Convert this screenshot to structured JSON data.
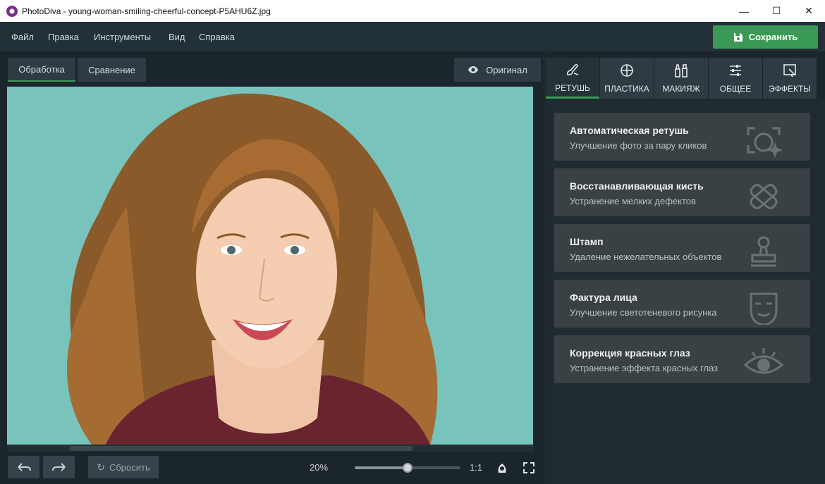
{
  "window": {
    "title": "PhotoDiva - young-woman-smiling-cheerful-concept-P5AHU6Z.jpg",
    "controls": {
      "minimize": "—",
      "maximize": "☐",
      "close": "✕"
    }
  },
  "menu": {
    "items": [
      "Файл",
      "Правка",
      "Инструменты",
      "Вид",
      "Справка"
    ],
    "save_label": "Сохранить"
  },
  "view_tabs": [
    {
      "label": "Обработка",
      "active": true
    },
    {
      "label": "Сравнение",
      "active": false
    }
  ],
  "original_label": "Оригинал",
  "canvas": {
    "background_color": "#78c4bd"
  },
  "bottom": {
    "reset_label": "Сбросить",
    "zoom": "20%",
    "zoom_fraction": 0.5,
    "one_to_one": "1:1"
  },
  "tool_tabs": [
    {
      "label": "РЕТУШЬ",
      "icon": "brush-retouch-icon",
      "active": true
    },
    {
      "label": "ПЛАСТИКА",
      "icon": "crosshair-icon",
      "active": false
    },
    {
      "label": "МАКИЯЖ",
      "icon": "makeup-icon",
      "active": false
    },
    {
      "label": "ОБЩЕЕ",
      "icon": "sliders-icon",
      "active": false
    },
    {
      "label": "ЭФФЕКТЫ",
      "icon": "effects-icon",
      "active": false
    }
  ],
  "tools": [
    {
      "title": "Автоматическая ретушь",
      "desc": "Улучшение фото за пару кликов",
      "icon": "auto-retouch-icon"
    },
    {
      "title": "Восстанавливающая кисть",
      "desc": "Устранение мелких дефектов",
      "icon": "bandage-icon"
    },
    {
      "title": "Штамп",
      "desc": "Удаление нежелательных объектов",
      "icon": "stamp-icon"
    },
    {
      "title": "Фактура лица",
      "desc": "Улучшение светотеневого рисунка",
      "icon": "face-mask-icon"
    },
    {
      "title": "Коррекция красных глаз",
      "desc": "Устранение эффекта красных глаз",
      "icon": "eye-icon"
    }
  ],
  "colors": {
    "accent": "#3a9a55",
    "panel": "#1b262c",
    "card": "#3a4145"
  }
}
